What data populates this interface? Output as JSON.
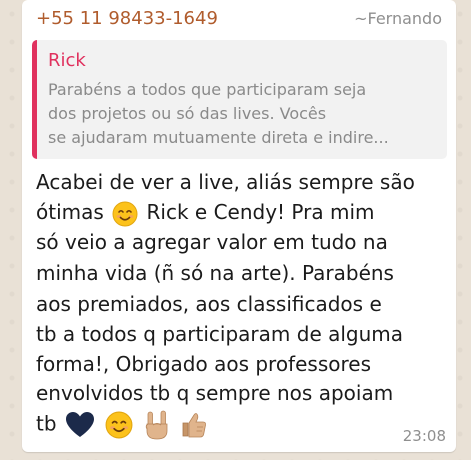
{
  "message": {
    "sender_phone": "+55 11 98433-1649",
    "sender_name": "~Fernando",
    "quote": {
      "author": "Rick",
      "lines": [
        "Parabéns a todos que participaram seja",
        "dos projetos ou só das lives. Vocês",
        "se ajudaram mutuamente direta e indire..."
      ]
    },
    "text": {
      "line1": "Acabei de ver a live, aliás sempre são",
      "line2a": "ótimas",
      "line2b": "Rick e Cendy! Pra mim",
      "line3": "só veio a agregar valor em tudo na",
      "line4": "minha vida (ñ só na arte). Parabéns",
      "line5": "aos premiados, aos classificados e",
      "line6": "tb a todos q participaram de alguma",
      "line7": "forma!,  Obrigado aos professores",
      "line8": "envolvidos tb q sempre nos apoiam",
      "line9": "tb"
    },
    "emojis": [
      "smiling-face-icon",
      "dark-blue-heart-icon",
      "smiling-face-icon",
      "sign-of-horns-icon",
      "thumbs-up-icon"
    ],
    "time": "23:08"
  },
  "colors": {
    "background": "#e9e1d6",
    "bubble": "#ffffff",
    "sender_phone": "#b05c2d",
    "quote_accent": "#e0315e",
    "quote_bg": "#f2f2f2",
    "meta_text": "#8f8f8f"
  }
}
